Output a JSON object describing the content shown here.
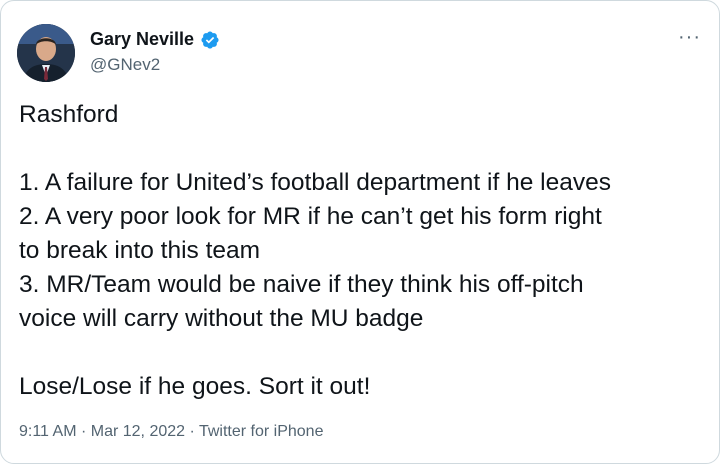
{
  "author": {
    "display_name": "Gary Neville",
    "handle": "@GNev2",
    "verified": true
  },
  "more_icon": "ellipsis-icon",
  "tweet": {
    "title_line": "Rashford",
    "lines": [
      "1. A failure for United’s football department if he leaves",
      "2. A very poor look for MR if he can’t get his form right",
      "to break into this team",
      "3. MR/Team would be naive if they think his off-pitch",
      "voice will carry without the MU badge"
    ],
    "closing_line": "Lose/Lose if he goes. Sort it out!"
  },
  "meta": {
    "time": "9:11 AM",
    "date": "Mar 12, 2022",
    "source": "Twitter for iPhone"
  },
  "colors": {
    "verified_blue": "#1d9bf0",
    "text_primary": "#0f1419",
    "text_secondary": "#536471"
  }
}
